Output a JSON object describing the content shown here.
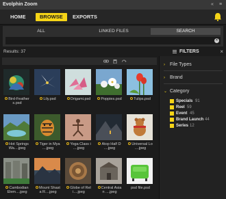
{
  "window": {
    "title": "Evolphin Zoom",
    "collapse_glyph": "«",
    "menu_glyph": "≡"
  },
  "nav": {
    "items": [
      {
        "label": "HOME",
        "active": false
      },
      {
        "label": "BROWSE",
        "active": true
      },
      {
        "label": "EXPORTS",
        "active": false
      }
    ],
    "notification_icon": "bell-icon"
  },
  "scope": {
    "tabs": [
      {
        "label": "ALL",
        "active": false
      },
      {
        "label": "LINKED FILES",
        "active": false
      },
      {
        "label": "SEARCH",
        "active": true
      }
    ],
    "search": {
      "value": "",
      "placeholder": ""
    },
    "clear_glyph": "×"
  },
  "results": {
    "label": "Results: 37"
  },
  "filters": {
    "label": "FILTERS",
    "close_glyph": "×"
  },
  "toolbar": {
    "icons": [
      "link-icon",
      "trash-icon",
      "refresh-icon"
    ]
  },
  "assets": [
    {
      "name": "Bird-Feather s.psd",
      "line1": "Bird-Feather",
      "line2": "s.psd"
    },
    {
      "name": "Lily.psd",
      "line1": "Lily.psd",
      "line2": ""
    },
    {
      "name": "Origami.psd",
      "line1": "Origami.psd",
      "line2": ""
    },
    {
      "name": "Poppies.psd",
      "line1": "Poppies.psd",
      "line2": ""
    },
    {
      "name": "Tulips.psd",
      "line1": "Tulips.psd",
      "line2": ""
    },
    {
      "name": "Hot Springs Wa....jpeg",
      "line1": "Hot Springs",
      "line2": "Wa....jpeg"
    },
    {
      "name": "Tiger in Mya....jpeg",
      "line1": "Tiger in Mya",
      "line2": "....jpeg"
    },
    {
      "name": "Yoga Class i....jpeg",
      "line1": "Yoga Class i",
      "line2": "....jpeg"
    },
    {
      "name": "Atop Half D....jpeg",
      "line1": "Atop Half D",
      "line2": "....jpeg"
    },
    {
      "name": "Universal Lo....jpeg",
      "line1": "Universal Lo",
      "line2": "....jpeg"
    },
    {
      "name": "Cambodian Elem....jpeg",
      "line1": "Cambodian",
      "line2": "Elem....jpeg"
    },
    {
      "name": "Mount Shast a R....jpeg",
      "line1": "Mount Shast",
      "line2": "a R....jpeg"
    },
    {
      "name": "Globe of Rel i....jpeg",
      "line1": "Globe of Rel",
      "line2": "i....jpeg"
    },
    {
      "name": "Central Asia n ....jpeg",
      "line1": "Central Asia",
      "line2": "n ....jpeg"
    },
    {
      "name": "psd file.psd",
      "line1": "psd file.psd",
      "line2": ""
    }
  ],
  "facets": [
    {
      "label": "File Types",
      "expanded": false,
      "chevron": "›"
    },
    {
      "label": "Brand",
      "expanded": false,
      "chevron": "›"
    },
    {
      "label": "Category",
      "expanded": true,
      "chevron": "⌄"
    }
  ],
  "categories": [
    {
      "name": "Specials",
      "count": "91",
      "checked": true
    },
    {
      "name": "Reel",
      "count": "59",
      "checked": true
    },
    {
      "name": "Event",
      "count": "45",
      "checked": true
    },
    {
      "name": "Brand Launch",
      "count": "44",
      "checked": true
    },
    {
      "name": "Series",
      "count": "12",
      "checked": true
    }
  ],
  "colors": {
    "accent": "#f5d417",
    "background": "#1c1c1c",
    "panel": "#2e2e2e"
  }
}
